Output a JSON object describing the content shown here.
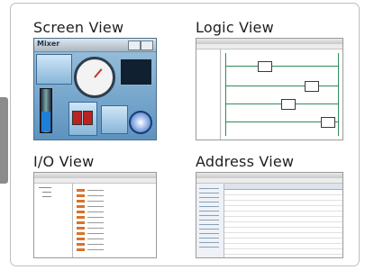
{
  "views": {
    "screen": {
      "title": "Screen View",
      "window_label": "Mixer"
    },
    "logic": {
      "title": "Logic View"
    },
    "io": {
      "title": "I/O View"
    },
    "address": {
      "title": "Address View"
    }
  },
  "colors": {
    "frame_border": "#bdbdbd",
    "side_tab": "#8c8c8c",
    "ladder_green": "#2e8b57",
    "io_item_orange": "#d9722a",
    "screen_blue": "#5d93bf"
  }
}
